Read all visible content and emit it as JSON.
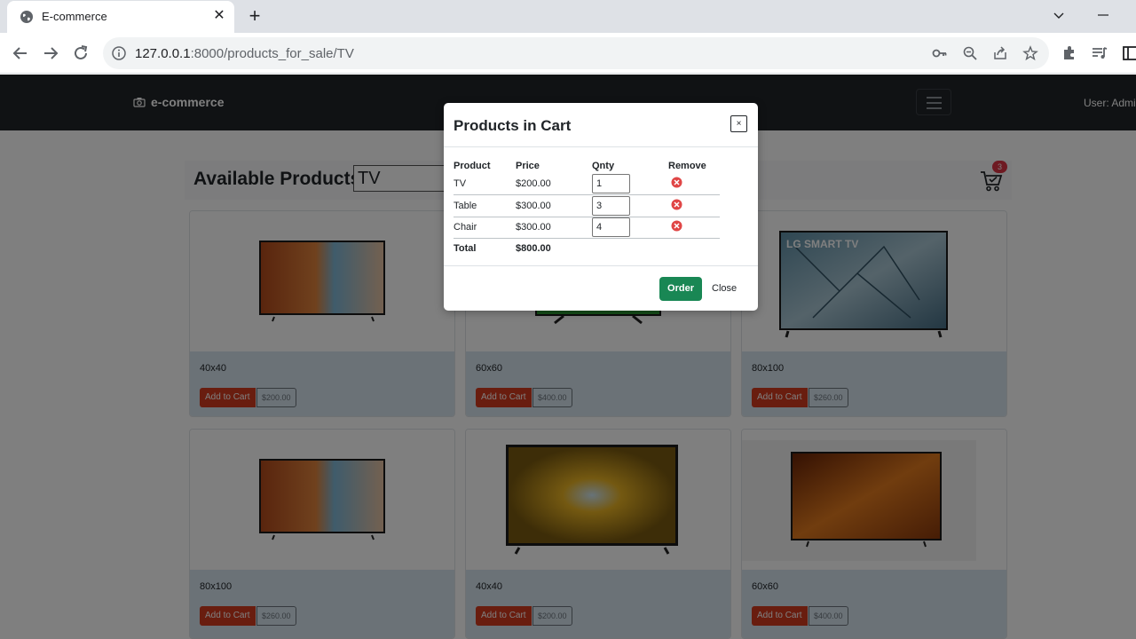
{
  "browser": {
    "tab_title": "E-commerce",
    "tab_close": "✕",
    "new_tab": "+",
    "url_host": "127.0.0.1",
    "url_rest": ":8000/products_for_sale/TV"
  },
  "site": {
    "brand": "e-commerce",
    "user": "User: Admin"
  },
  "products_header": {
    "title": "Available Products",
    "search_value": "TV",
    "cart_count": "3"
  },
  "products": [
    {
      "name": "40x40",
      "add_label": "Add to Cart",
      "price": "$200.00",
      "image": "tv-canyon"
    },
    {
      "name": "60x60",
      "add_label": "Add to Cart",
      "price": "$400.00",
      "image": "tv-green"
    },
    {
      "name": "80x100",
      "add_label": "Add to Cart",
      "price": "$260.00",
      "image": "tv-lg-leaf",
      "image_text": "LG SMART TV"
    },
    {
      "name": "80x100",
      "add_label": "Add to Cart",
      "price": "$260.00",
      "image": "tv-canyon"
    },
    {
      "name": "40x40",
      "add_label": "Add to Cart",
      "price": "$200.00",
      "image": "tv-forest"
    },
    {
      "name": "60x60",
      "add_label": "Add to Cart",
      "price": "$400.00",
      "image": "tv-desert"
    }
  ],
  "modal": {
    "title": "Products in Cart",
    "close_x": "×",
    "headers": {
      "product": "Product",
      "price": "Price",
      "qty": "Qnty",
      "remove": "Remove"
    },
    "rows": [
      {
        "product": "TV",
        "price": "$200.00",
        "qty": "1"
      },
      {
        "product": "Table",
        "price": "$300.00",
        "qty": "3"
      },
      {
        "product": "Chair",
        "price": "$300.00",
        "qty": "4"
      }
    ],
    "total_label": "Total",
    "total_value": "$800.00",
    "order_label": "Order",
    "close_label": "Close"
  },
  "colors": {
    "navbar": "#212529",
    "add_to_cart": "#d23b1f",
    "order_button": "#198754",
    "badge": "#dc3545",
    "remove_icon": "#e04646"
  }
}
